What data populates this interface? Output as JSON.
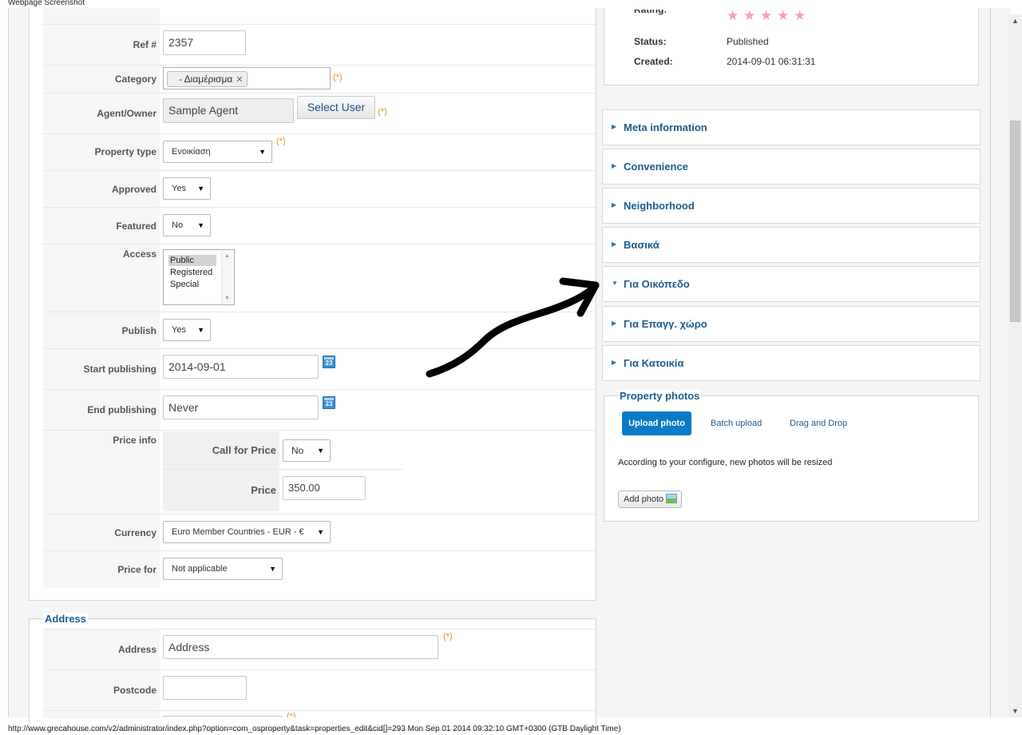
{
  "captions": {
    "top": "Webpage Screenshot",
    "bottom": "http://www.grecahouse.com/v2/administrator/index.php?option=com_osproperty&task=properties_edit&cid[]=293 Mon Sep 01 2014 09:32:10 GMT+0300 (GTB Daylight Time)"
  },
  "required_mark": "(*)",
  "form": {
    "ref": {
      "label": "Ref #",
      "value": "2357"
    },
    "category": {
      "label": "Category",
      "chip": "- Διαμέρισμα",
      "chip_remove": "✕"
    },
    "agent": {
      "label": "Agent/Owner",
      "value": "Sample Agent",
      "button": "Select User"
    },
    "property_type": {
      "label": "Property type",
      "value": "Ενοικίαση"
    },
    "approved": {
      "label": "Approved",
      "value": "Yes"
    },
    "featured": {
      "label": "Featured",
      "value": "No"
    },
    "access": {
      "label": "Access",
      "options": [
        "Public",
        "Registered",
        "Special"
      ],
      "selected": "Public"
    },
    "publish": {
      "label": "Publish",
      "value": "Yes"
    },
    "start_publishing": {
      "label": "Start publishing",
      "value": "2014-09-01"
    },
    "end_publishing": {
      "label": "End publishing",
      "value": "Never"
    },
    "price_info": {
      "label": "Price info",
      "call_for_price": {
        "label": "Call for Price",
        "value": "No"
      },
      "price": {
        "label": "Price",
        "value": "350.00"
      }
    },
    "currency": {
      "label": "Currency",
      "value": "Euro Member Countries - EUR - €"
    },
    "price_for": {
      "label": "Price for",
      "value": "Not applicable"
    },
    "calendar_day": "23"
  },
  "address_section": {
    "legend": "Address",
    "address": {
      "label": "Address",
      "placeholder": "Address"
    },
    "postcode": {
      "label": "Postcode",
      "value": ""
    }
  },
  "info": {
    "rating_label": "Rating:",
    "rating_stars": 5,
    "star_glyph": "★",
    "status": {
      "label": "Status:",
      "value": "Published"
    },
    "created": {
      "label": "Created:",
      "value": "2014-09-01 06:31:31"
    }
  },
  "accordions": [
    {
      "title": "Meta information",
      "expanded": false
    },
    {
      "title": "Convenience",
      "expanded": false
    },
    {
      "title": "Neighborhood",
      "expanded": false
    },
    {
      "title": "Βασικά",
      "expanded": false
    },
    {
      "title": "Για Οικόπεδο",
      "expanded": true
    },
    {
      "title": "Για Επαγγ. χώρο",
      "expanded": false
    },
    {
      "title": "Για Κατοικία",
      "expanded": false
    }
  ],
  "photos": {
    "legend": "Property photos",
    "tabs": [
      "Upload photo",
      "Batch upload",
      "Drag and Drop"
    ],
    "active_tab": "Upload photo",
    "note": "According to your configure, new photos will be resized",
    "add_button": "Add photo"
  },
  "icons": {
    "dropdown": "▼",
    "tri_right": "▶",
    "tri_down": "▼",
    "scroll_up": "▲",
    "scroll_down": "▼"
  },
  "colors": {
    "accent_blue": "#1e5b8e",
    "active_tab": "#0a7ac7",
    "required": "#f0891f",
    "star": "#f4a0c0"
  }
}
